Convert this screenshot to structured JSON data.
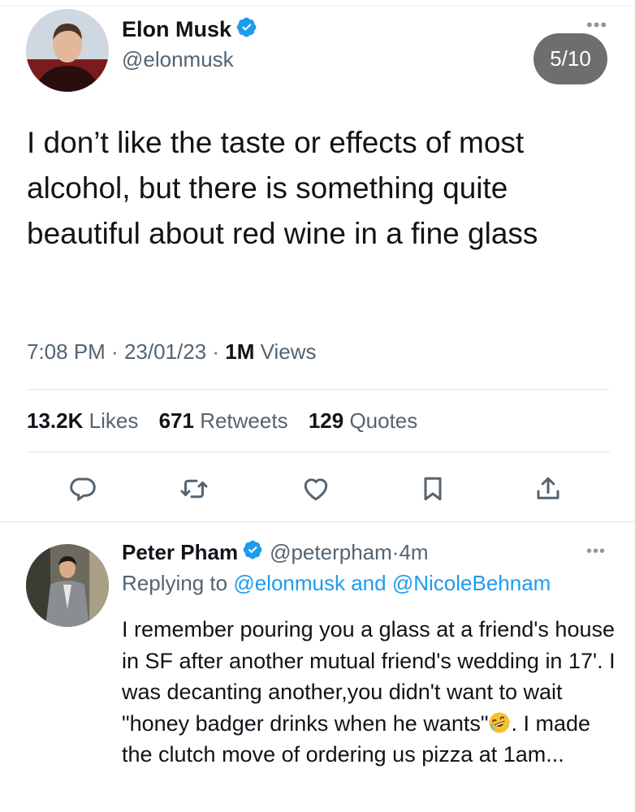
{
  "tweet": {
    "author": {
      "name": "Elon Musk",
      "handle": "@elonmusk",
      "verified": true
    },
    "pager": "5/10",
    "text": "I don’t like the taste or effects of most alcohol, but there is something quite beautiful about red wine in a fine glass",
    "time": "7:08 PM",
    "date": "23/01/23",
    "separator": " · ",
    "views_count": "1M",
    "views_label": "Views",
    "stats": {
      "likes_count": "13.2K",
      "likes_label": "Likes",
      "retweets_count": "671",
      "retweets_label": "Retweets",
      "quotes_count": "129",
      "quotes_label": "Quotes"
    },
    "actions": [
      "reply-icon",
      "retweet-icon",
      "like-icon",
      "bookmark-icon",
      "share-icon"
    ]
  },
  "reply": {
    "author": {
      "name": "Peter Pham",
      "handle": "@peterpham",
      "verified": true
    },
    "age": "4m",
    "replying_prefix": "Replying to",
    "replying_to_1": "@elonmusk",
    "replying_and": "and",
    "replying_to_2": "@NicoleBehnam",
    "text_part1": "I remember pouring you a glass at a friend's house in SF after another mutual friend's wedding in 17'.  I was decanting another,you didn't want to wait \"honey badger drinks when he wants\"",
    "emoji": "rolling-on-the-floor-laughing",
    "text_part2": ". I made the clutch move of ordering us pizza at 1am..."
  },
  "more_icon": "•••",
  "colors": {
    "accent": "#1d9bf0",
    "text": "#0f1419",
    "secondary": "#536471",
    "icon": "#536471",
    "pager_bg": "#6e6e6e"
  }
}
